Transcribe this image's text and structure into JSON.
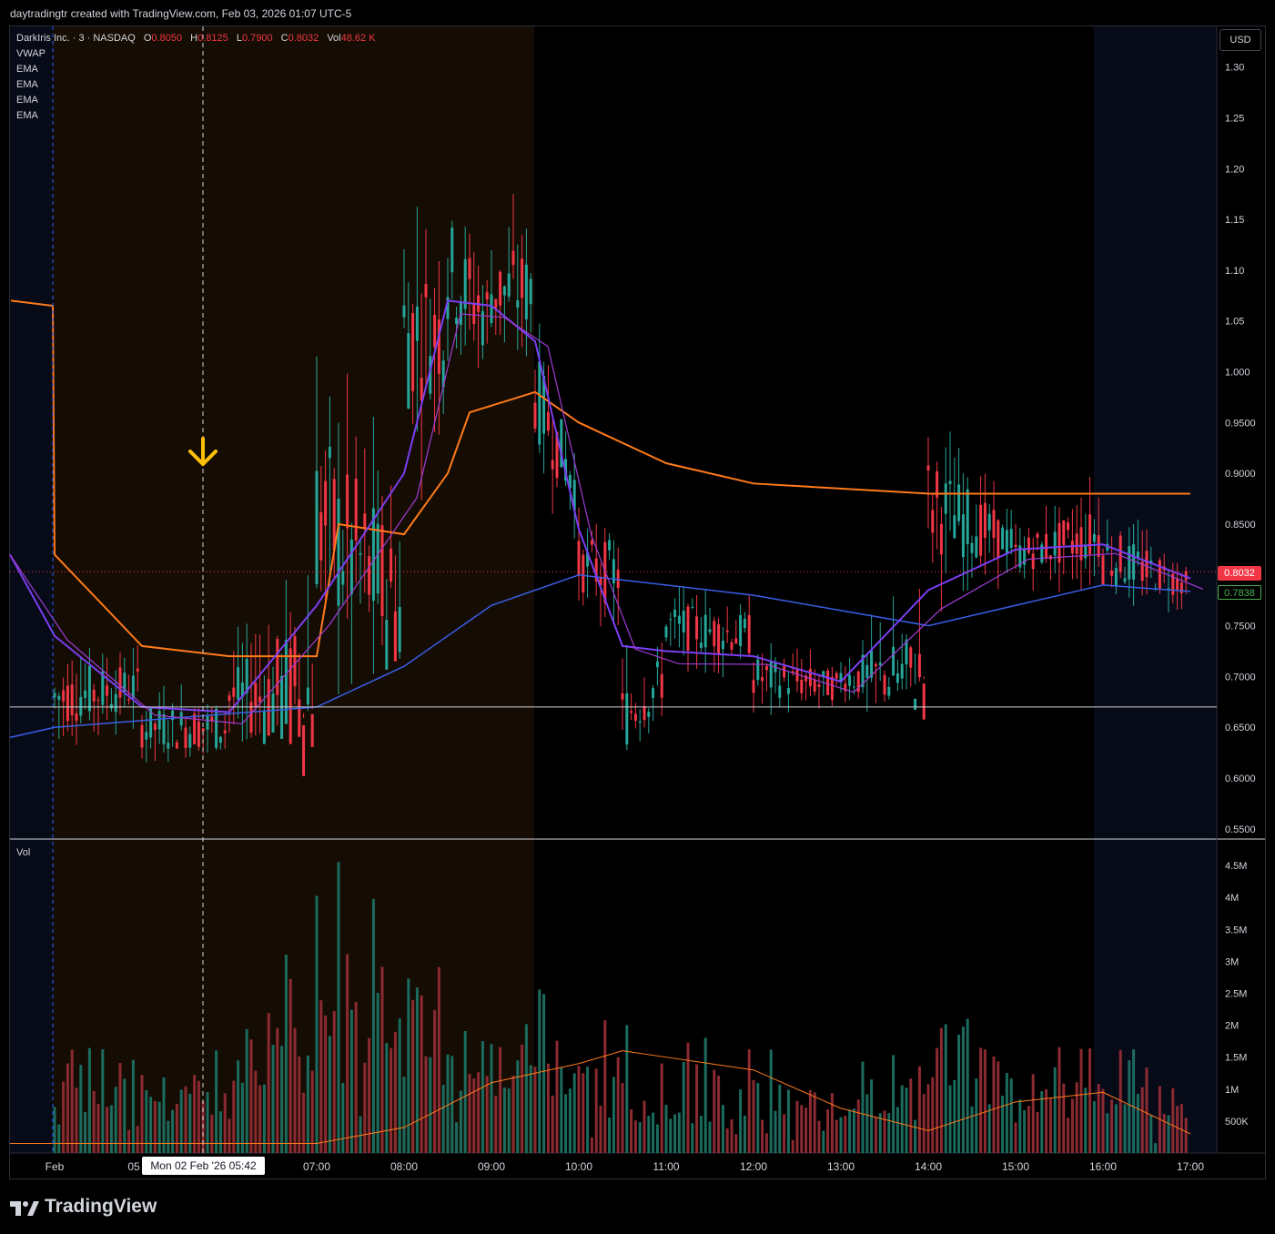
{
  "header": {
    "attribution": "daytradingtr created with TradingView.com, Feb 03, 2026 01:07 UTC-5"
  },
  "legend": {
    "symbol": "DarkIris Inc. · 3 · NASDAQ",
    "o_label": "O",
    "o_value": "0.8050",
    "h_label": "H",
    "h_value": "0.8125",
    "l_label": "L",
    "l_value": "0.7900",
    "c_label": "C",
    "c_value": "0.8032",
    "vol_label": "Vol",
    "vol_value": "48.62 K",
    "indicators": [
      "VWAP",
      "EMA",
      "EMA",
      "EMA",
      "EMA"
    ]
  },
  "currency_button": "USD",
  "price_tags": {
    "last": "0.8032",
    "vwap": "0.7838"
  },
  "volume_pane_label": "Vol",
  "crosshair_time_tooltip": "Mon 02 Feb '26   05:42",
  "footer": {
    "brand": "TradingView"
  },
  "colors": {
    "up": "#26a69a",
    "down": "#f23645",
    "vwap": "#3a5ee8",
    "ema_orange": "#ff7a1a",
    "ema_purple": "#7b3ff2",
    "ema_violet": "#a13bd6",
    "premarket_bg": "#150d03",
    "ext_hours_bg": "#070b18",
    "arrow": "#ffc107"
  },
  "chart_data": {
    "type": "candlestick",
    "interval": "3",
    "x_ticks": [
      "Feb",
      "05",
      "07:00",
      "08:00",
      "09:00",
      "10:00",
      "11:00",
      "12:00",
      "13:00",
      "14:00",
      "15:00",
      "16:00",
      "17:00"
    ],
    "price_axis": {
      "ticks": [
        "1.30",
        "1.25",
        "1.20",
        "1.15",
        "1.10",
        "1.05",
        "1.000",
        "0.9500",
        "0.9000",
        "0.8500",
        "0.8032",
        "0.7838",
        "0.7500",
        "0.7000",
        "0.6500",
        "0.6000",
        "0.5500"
      ],
      "ylim": [
        0.54,
        1.34
      ]
    },
    "volume_axis": {
      "ticks": [
        "4.5M",
        "4M",
        "3.5M",
        "3M",
        "2.5M",
        "2M",
        "1.5M",
        "1M",
        "500K"
      ],
      "ylim": [
        0,
        4.8
      ]
    },
    "horizontal_line": 0.67,
    "ohlc_keypoints": [
      {
        "t": "prior",
        "o": 1.07,
        "h": 1.07,
        "l": 1.07,
        "c": 1.07
      },
      {
        "t": "04:00",
        "o": 0.8,
        "h": 0.82,
        "l": 0.64,
        "c": 0.68
      },
      {
        "t": "05:00",
        "o": 0.69,
        "h": 0.73,
        "l": 0.61,
        "c": 0.65
      },
      {
        "t": "06:00",
        "o": 0.65,
        "h": 0.77,
        "l": 0.63,
        "c": 0.68
      },
      {
        "t": "07:00",
        "o": 0.68,
        "h": 1.2,
        "l": 0.67,
        "c": 0.86
      },
      {
        "t": "08:00",
        "o": 0.76,
        "h": 1.17,
        "l": 0.72,
        "c": 1.04
      },
      {
        "t": "08:30",
        "o": 1.04,
        "h": 1.27,
        "l": 0.96,
        "c": 1.1
      },
      {
        "t": "09:00",
        "o": 1.05,
        "h": 1.19,
        "l": 0.96,
        "c": 1.08
      },
      {
        "t": "09:30",
        "o": 1.08,
        "h": 1.19,
        "l": 0.94,
        "c": 0.98
      },
      {
        "t": "10:00",
        "o": 0.88,
        "h": 0.89,
        "l": 0.74,
        "c": 0.81
      },
      {
        "t": "10:30",
        "o": 0.8,
        "h": 0.82,
        "l": 0.62,
        "c": 0.66
      },
      {
        "t": "11:00",
        "o": 0.7,
        "h": 0.79,
        "l": 0.66,
        "c": 0.75
      },
      {
        "t": "12:00",
        "o": 0.74,
        "h": 0.78,
        "l": 0.66,
        "c": 0.7
      },
      {
        "t": "13:00",
        "o": 0.69,
        "h": 0.73,
        "l": 0.65,
        "c": 0.7
      },
      {
        "t": "14:00",
        "o": 0.7,
        "h": 0.99,
        "l": 0.7,
        "c": 0.87
      },
      {
        "t": "15:00",
        "o": 0.83,
        "h": 0.86,
        "l": 0.77,
        "c": 0.82
      },
      {
        "t": "16:00",
        "o": 0.84,
        "h": 0.96,
        "l": 0.79,
        "c": 0.82
      },
      {
        "t": "17:00",
        "o": 0.79,
        "h": 0.8,
        "l": 0.73,
        "c": 0.8032
      }
    ],
    "vwap_keypoints": [
      {
        "t": "04:00",
        "v": 0.65
      },
      {
        "t": "07:00",
        "v": 0.67
      },
      {
        "t": "08:00",
        "v": 0.71
      },
      {
        "t": "09:00",
        "v": 0.77
      },
      {
        "t": "10:00",
        "v": 0.8
      },
      {
        "t": "12:00",
        "v": 0.78
      },
      {
        "t": "14:00",
        "v": 0.75
      },
      {
        "t": "15:00",
        "v": 0.77
      },
      {
        "t": "16:00",
        "v": 0.79
      },
      {
        "t": "17:00",
        "v": 0.7838
      }
    ],
    "volume_avg_keypoints": [
      {
        "t": "04:00",
        "v": 0.15
      },
      {
        "t": "07:00",
        "v": 0.15
      },
      {
        "t": "08:00",
        "v": 0.4
      },
      {
        "t": "09:00",
        "v": 1.1
      },
      {
        "t": "10:00",
        "v": 1.4
      },
      {
        "t": "10:30",
        "v": 1.6
      },
      {
        "t": "11:00",
        "v": 1.5
      },
      {
        "t": "12:00",
        "v": 1.3
      },
      {
        "t": "13:00",
        "v": 0.7
      },
      {
        "t": "14:00",
        "v": 0.35
      },
      {
        "t": "15:00",
        "v": 0.8
      },
      {
        "t": "16:00",
        "v": 0.95
      },
      {
        "t": "17:00",
        "v": 0.3
      }
    ]
  }
}
